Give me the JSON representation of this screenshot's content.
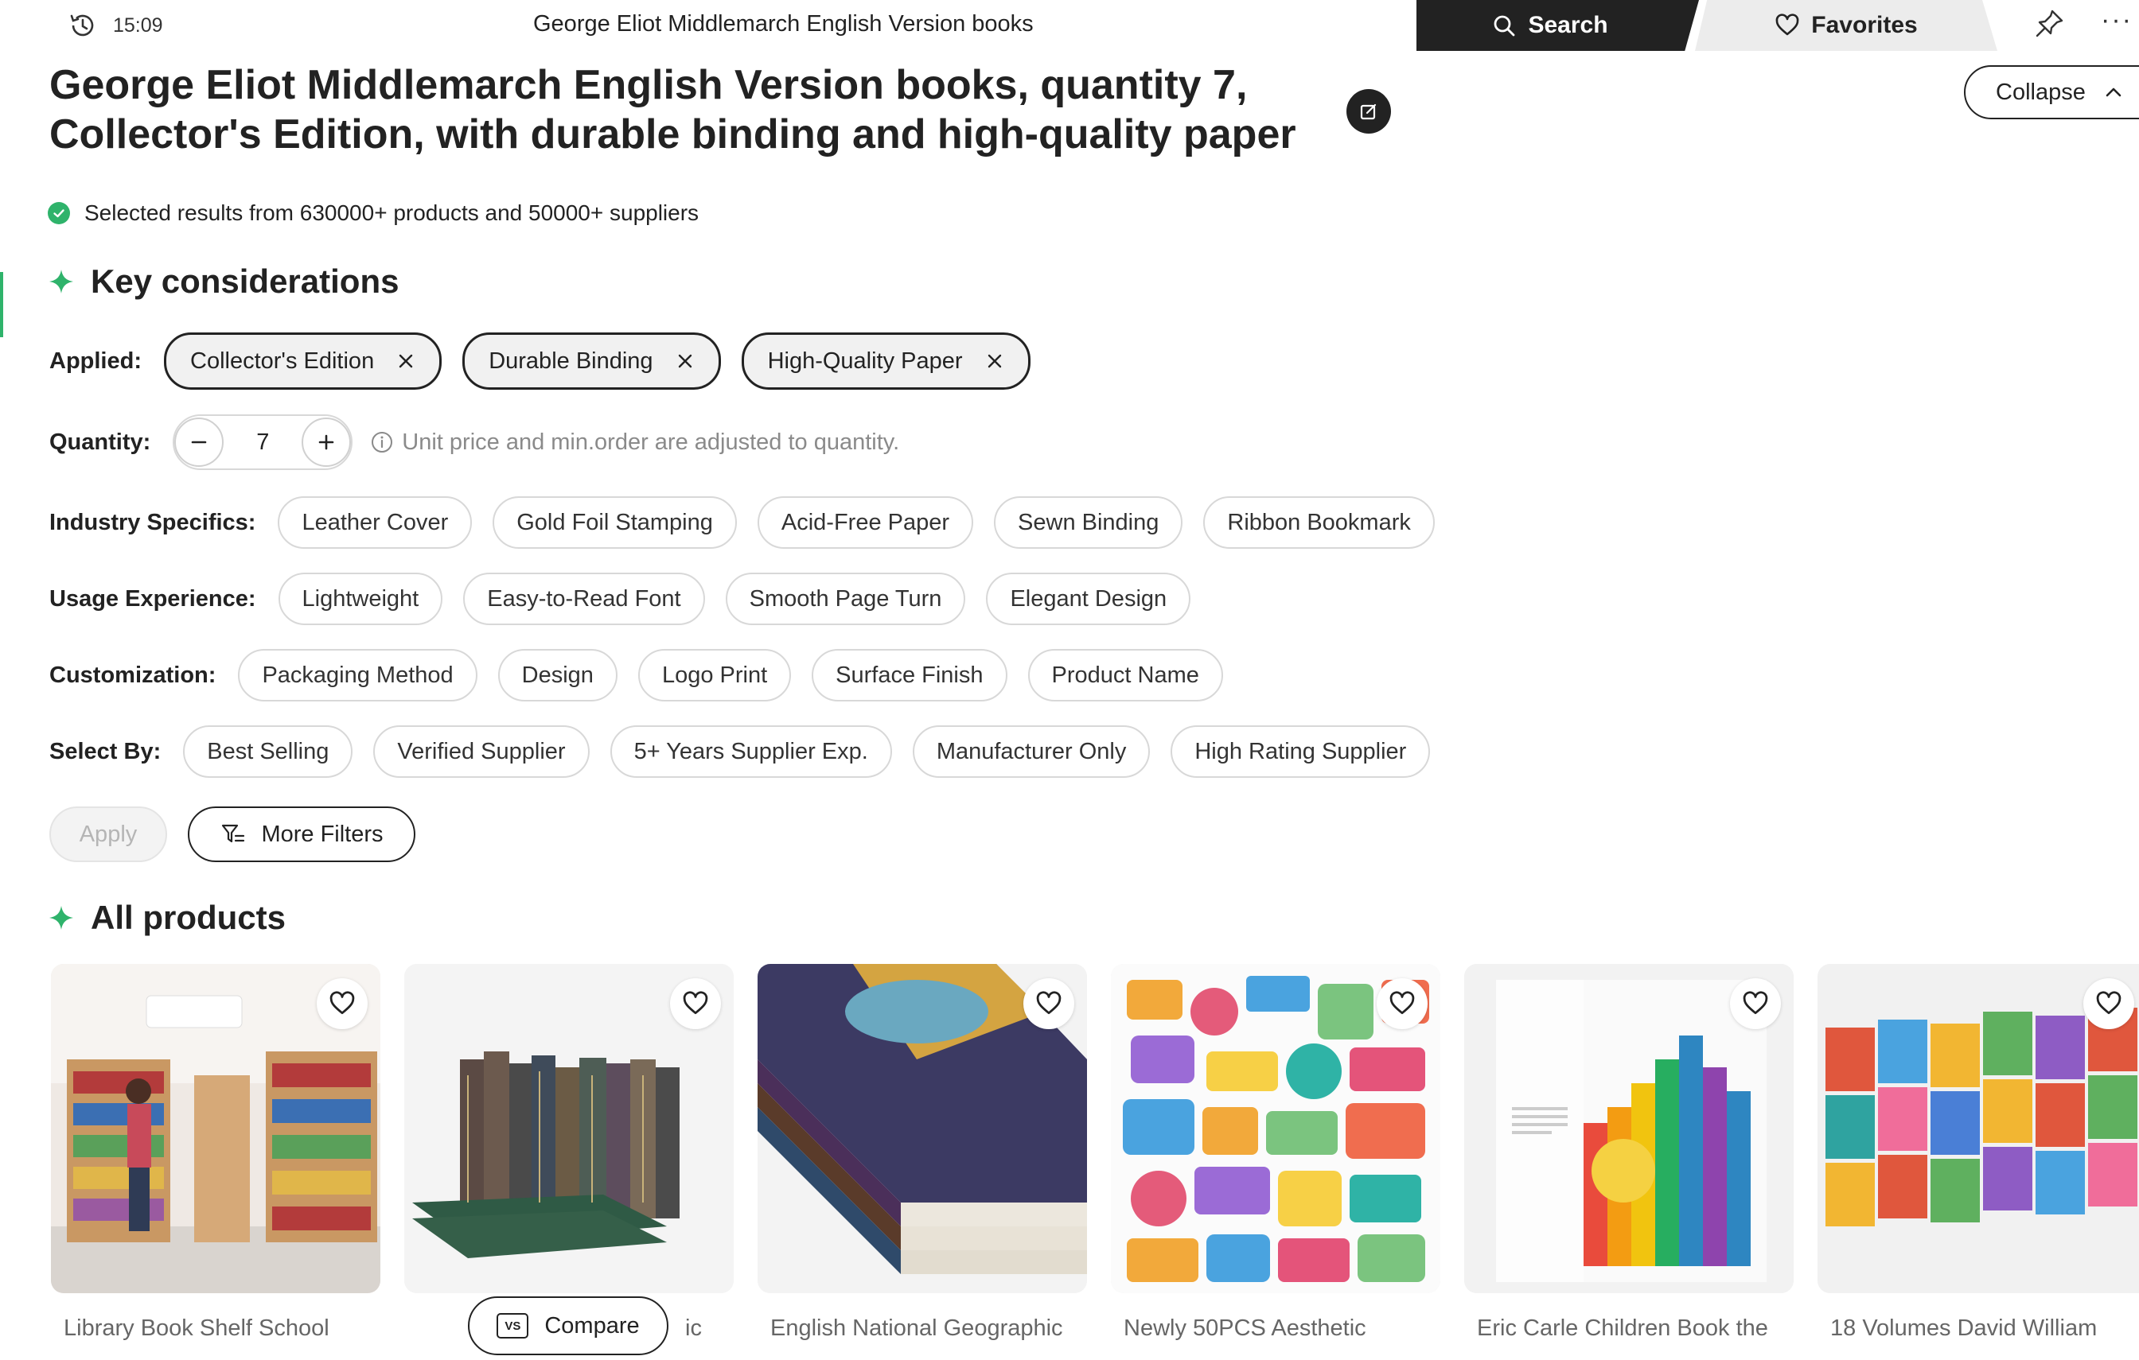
{
  "topbar": {
    "time": "15:09",
    "tab_title": "George Eliot Middlemarch English Version books",
    "search_label": "Search",
    "favorites_label": "Favorites",
    "more_label": "···"
  },
  "header": {
    "title": "George Eliot Middlemarch English Version books, quantity 7, Collector's Edition, with durable binding and high-quality paper",
    "collapse_label": "Collapse",
    "selected_note": "Selected results from 630000+ products and 50000+ suppliers"
  },
  "key_considerations": {
    "heading": "Key considerations",
    "applied_label": "Applied:",
    "applied": [
      "Collector's Edition",
      "Durable Binding",
      "High-Quality Paper"
    ],
    "quantity_label": "Quantity:",
    "quantity_value": "7",
    "quantity_note": "Unit price and min.order are adjusted to quantity.",
    "industry_label": "Industry Specifics:",
    "industry": [
      "Leather Cover",
      "Gold Foil Stamping",
      "Acid-Free Paper",
      "Sewn Binding",
      "Ribbon Bookmark"
    ],
    "usage_label": "Usage Experience:",
    "usage": [
      "Lightweight",
      "Easy-to-Read Font",
      "Smooth Page Turn",
      "Elegant Design"
    ],
    "custom_label": "Customization:",
    "custom": [
      "Packaging Method",
      "Design",
      "Logo Print",
      "Surface Finish",
      "Product Name"
    ],
    "selectby_label": "Select By:",
    "selectby": [
      "Best Selling",
      "Verified Supplier",
      "5+ Years Supplier Exp.",
      "Manufacturer Only",
      "High Rating Supplier"
    ],
    "apply_label": "Apply",
    "more_filters_label": "More Filters"
  },
  "products": {
    "heading": "All products",
    "items": [
      {
        "name": "Library Book Shelf School"
      },
      {
        "name": "ic"
      },
      {
        "name": "English National Geographic"
      },
      {
        "name": "Newly 50PCS Aesthetic"
      },
      {
        "name": "Eric Carle Children Book the"
      },
      {
        "name": "18 Volumes David William"
      }
    ],
    "compare_label": "Compare",
    "compare_badge": "VS"
  },
  "colors": {
    "accent_green": "#2fb36b",
    "dark": "#222222",
    "chip_border": "#d8d8d8"
  }
}
